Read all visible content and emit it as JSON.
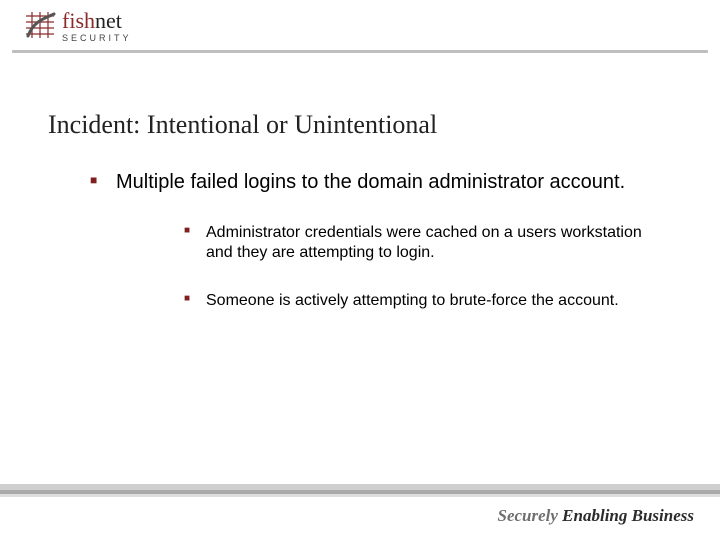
{
  "logo": {
    "name_pre": "fish",
    "name_post": "net",
    "subtitle": "SECURITY"
  },
  "title": "Incident: Intentional or Unintentional",
  "bullets": {
    "main": "Multiple failed logins to the domain administrator account.",
    "subs": [
      "Administrator credentials were cached on a users workstation and they are attempting to login.",
      "Someone is actively attempting to brute-force the account."
    ]
  },
  "tagline": {
    "word1": "Securely",
    "word2": "Enabling",
    "word3": "Business"
  },
  "colors": {
    "brand_red": "#8a2a2a",
    "bullet_red": "#7f1f1f",
    "rule_grey": "#bfbfbf"
  }
}
